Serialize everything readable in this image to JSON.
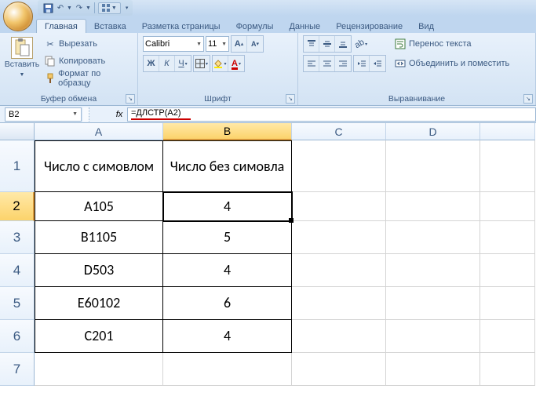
{
  "qat": {
    "save": "save",
    "undo": "undo",
    "redo": "redo"
  },
  "tabs": [
    "Главная",
    "Вставка",
    "Разметка страницы",
    "Формулы",
    "Данные",
    "Рецензирование",
    "Вид"
  ],
  "active_tab": 0,
  "clipboard": {
    "paste": "Вставить",
    "cut": "Вырезать",
    "copy": "Копировать",
    "format": "Формат по образцу",
    "label": "Буфер обмена"
  },
  "font": {
    "name": "Calibri",
    "size": "11",
    "label": "Шрифт"
  },
  "alignment": {
    "wrap": "Перенос текста",
    "merge": "Объединить и поместить",
    "label": "Выравнивание"
  },
  "formula_bar": {
    "name_box": "B2",
    "formula": "=ДЛСТР(A2)"
  },
  "columns": [
    "A",
    "B",
    "C",
    "D"
  ],
  "selected_col": 1,
  "selected_row": 2,
  "rows": [
    {
      "n": 1,
      "A": "Число с симовлом",
      "B": "Число без симовла"
    },
    {
      "n": 2,
      "A": "A105",
      "B": "4"
    },
    {
      "n": 3,
      "A": "B1105",
      "B": "5"
    },
    {
      "n": 4,
      "A": "D503",
      "B": "4"
    },
    {
      "n": 5,
      "A": "E60102",
      "B": "6"
    },
    {
      "n": 6,
      "A": "C201",
      "B": "4"
    },
    {
      "n": 7,
      "A": "",
      "B": ""
    }
  ]
}
